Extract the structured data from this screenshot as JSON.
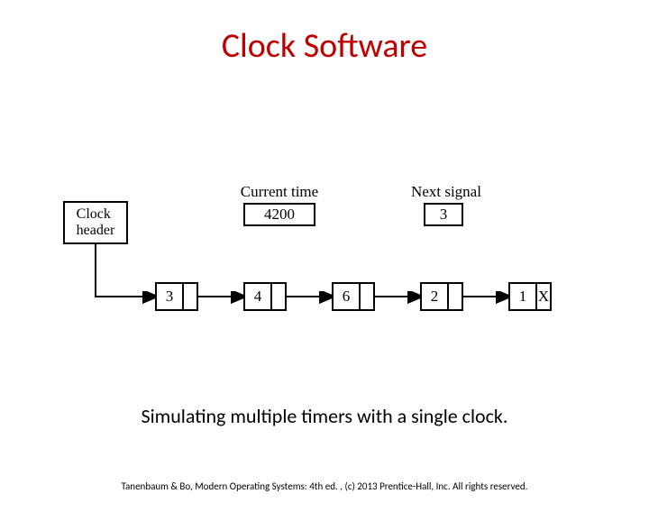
{
  "title": "Clock Software",
  "diagram": {
    "labels": {
      "current_time": "Current time",
      "next_signal": "Next signal",
      "clock_header": "Clock\nheader"
    },
    "current_time_value": "4200",
    "next_signal_value": "3",
    "nodes": [
      "3",
      "4",
      "6",
      "2",
      "1"
    ],
    "terminal": "X"
  },
  "caption": "Simulating multiple timers with a single clock.",
  "footer": "Tanenbaum & Bo, Modern  Operating Systems: 4th ed. , (c) 2013 Prentice-Hall, Inc. All rights reserved."
}
